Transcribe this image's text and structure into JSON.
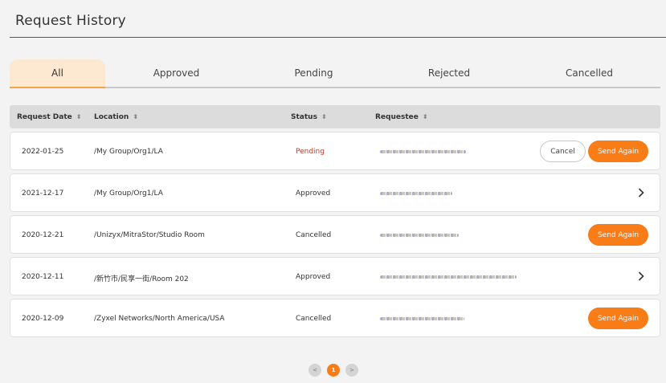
{
  "header": {
    "title": "Request History"
  },
  "tabs": [
    {
      "label": "All",
      "active": true
    },
    {
      "label": "Approved",
      "active": false
    },
    {
      "label": "Pending",
      "active": false
    },
    {
      "label": "Rejected",
      "active": false
    },
    {
      "label": "Cancelled",
      "active": false
    }
  ],
  "table": {
    "columns": {
      "request_date": "Request Date",
      "location": "Location",
      "status": "Status",
      "requestee": "Requestee"
    },
    "rows": [
      {
        "date": "2022-01-25",
        "location": "/My Group/Org1/LA",
        "status": "Pending"
      },
      {
        "date": "2021-12-17",
        "location": "/My Group/Org1/LA",
        "status": "Approved"
      },
      {
        "date": "2020-12-21",
        "location": "/Unizyx/MitraStor/Studio Room",
        "status": "Cancelled"
      },
      {
        "date": "2020-12-11",
        "location": "/新竹市/民享一街/Room 202",
        "status": "Approved"
      },
      {
        "date": "2020-12-09",
        "location": "/Zyxel Networks/North America/USA",
        "status": "Cancelled"
      }
    ]
  },
  "actions": {
    "cancel_label": "Cancel",
    "send_again_label": "Send Again"
  },
  "pagination": {
    "current_page": "1",
    "prev": "<",
    "next": ">"
  },
  "colors": {
    "accent": "#f97c16",
    "active_tab_bg": "#fde8d1",
    "pending": "#c0392b"
  }
}
